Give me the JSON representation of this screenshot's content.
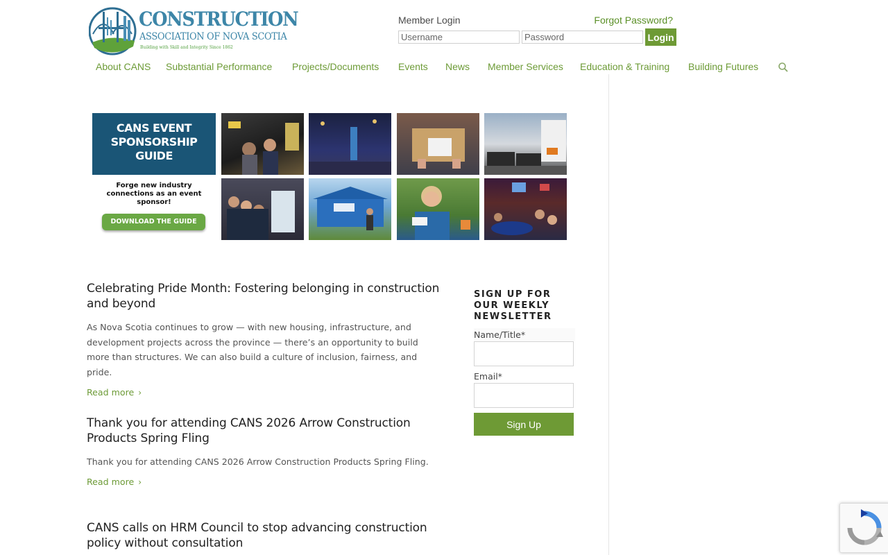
{
  "logo": {
    "line1": "CONSTRUCTION",
    "line2": "ASSOCIATION OF NOVA SCOTIA",
    "tagline": "Building with Skill and Integrity Since 1862"
  },
  "login": {
    "title": "Member Login",
    "forgot": "Forgot Password?",
    "username_placeholder": "Username",
    "password_placeholder": "Password",
    "button": "Login"
  },
  "nav": {
    "items": [
      "About CANS",
      "Substantial Performance",
      "Projects/Documents",
      "Events",
      "News",
      "Member Services",
      "Education & Training",
      "Building Futures"
    ],
    "search_icon": "search-icon"
  },
  "banner": {
    "headline": "CANS EVENT SPONSORSHIP GUIDE",
    "subtext": "Forge new industry connections as an event sponsor!",
    "button": "DOWNLOAD THE GUIDE"
  },
  "articles": [
    {
      "title": "Celebrating Pride Month: Fostering belonging in construction and beyond",
      "excerpt": "As Nova Scotia continues to grow — with new housing, infrastructure, and development projects across the province — there’s an opportunity to build more than structures. We can also build a culture of inclusion, fairness, and pride.",
      "read_more": "Read more"
    },
    {
      "title": "Thank you for attending CANS 2026 Arrow Construction Products Spring Fling",
      "excerpt": "Thank you for attending CANS 2026 Arrow Construction Products Spring Fling.",
      "read_more": "Read more"
    },
    {
      "title": "CANS calls on HRM Council to stop advancing construction policy without consultation"
    }
  ],
  "signup": {
    "title": "SIGN UP FOR OUR WEEKLY NEWSLETTER",
    "name_label": "Name/Title*",
    "email_label": "Email*",
    "button": "Sign Up"
  },
  "colors": {
    "brand_green": "#6d9b37",
    "brand_blue": "#3d86a8",
    "banner_navy": "#1a5576"
  }
}
